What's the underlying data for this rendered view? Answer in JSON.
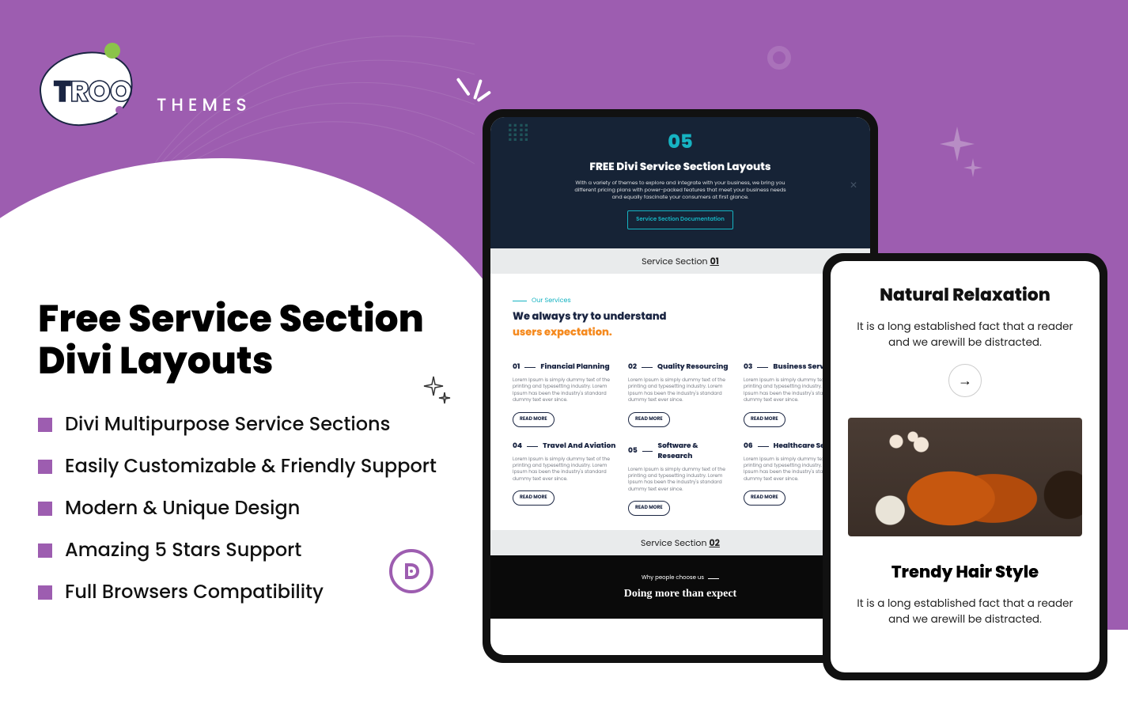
{
  "brand": {
    "name": "TROO",
    "suffix": "THEMES"
  },
  "hero": {
    "title_line1": "Free Service Section",
    "title_line2": "Divi Layouts"
  },
  "features": [
    "Divi Multipurpose Service Sections",
    "Easily Customizable & Friendly Support",
    "Modern & Unique Design",
    "Amazing 5 Stars Support",
    "Full Browsers Compatibility"
  ],
  "divi_badge_letter": "D",
  "tablet_big": {
    "hero_number": "05",
    "hero_title": "FREE Divi Service Section Layouts",
    "hero_desc": "With a variety of themes to explore and integrate with your business, we bring you different pricing plans with power-packed features that meet your business needs and equally fascinate your consumers at first glance.",
    "hero_button": "Service Section Documentation",
    "section1_label": "Service Section",
    "section1_num": "01",
    "eyebrow": "Our Services",
    "headline_a": "We always try to understand",
    "headline_b": "users expectation",
    "service_desc": "Lorem Ipsum is simply dummy text of the printing and typesetting industry. Lorem Ipsum has been the industry's standard dummy text ever since.",
    "read_more": "READ MORE",
    "services": [
      {
        "n": "01",
        "t": "Financial Planning"
      },
      {
        "n": "02",
        "t": "Quality Resourcing"
      },
      {
        "n": "03",
        "t": "Business Service"
      },
      {
        "n": "04",
        "t": "Travel And Aviation"
      },
      {
        "n": "05",
        "t": "Software & Research"
      },
      {
        "n": "06",
        "t": "Healthcare Serv"
      }
    ],
    "section2_label": "Service Section",
    "section2_num": "02",
    "why_label": "Why people choose us",
    "why_headline": "Doing more than expect"
  },
  "tablet_small": {
    "title1": "Natural Relaxation",
    "sub": "It is a long established fact that a reader and we arewill be distracted.",
    "arrow": "→",
    "title2": "Trendy Hair Style",
    "sub2": "It is a long established fact that a reader and we arewill be distracted."
  }
}
